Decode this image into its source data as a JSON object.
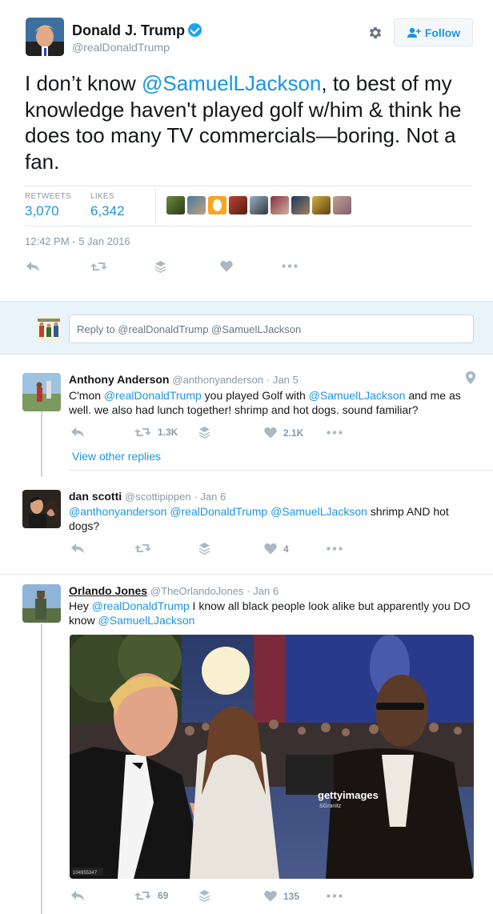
{
  "main_tweet": {
    "name": "Donald J. Trump",
    "handle": "@realDonaldTrump",
    "follow_label": "Follow",
    "text_before": "I don’t know ",
    "text_mention": "@SamuelLJackson",
    "text_after": ", to best of my knowledge haven't played golf w/him & think he does too many TV commercials—boring. Not a fan.",
    "retweets_label": "RETWEETS",
    "retweets": "3,070",
    "likes_label": "LIKES",
    "likes": "6,342",
    "timestamp": "12:42 PM - 5 Jan 2016"
  },
  "reply_box": {
    "placeholder": "Reply to @realDonaldTrump @SamuelLJackson"
  },
  "replies": [
    {
      "name": "Anthony Anderson",
      "handle": "@anthonyanderson",
      "date": "· Jan 5",
      "mention_a": "@realDonaldTrump",
      "mention_b": "@SamuelLJackson",
      "text_1": "C'mon ",
      "text_2": " you played Golf with ",
      "text_3": " and me as well. we also had lunch together! shrimp and hot dogs. sound familiar?",
      "retweets": "1.3K",
      "likes": "2.1K",
      "view_other": "View other replies"
    },
    {
      "name": "dan scotti",
      "handle": "@scottipippen",
      "date": "· Jan 6",
      "mention_a": "@anthonyanderson",
      "mention_b": "@realDonaldTrump",
      "mention_c": "@SamuelLJackson",
      "text_tail": " shrimp AND hot dogs?",
      "retweets": "",
      "likes": "4"
    },
    {
      "name": "Orlando Jones",
      "handle": "@TheOrlandoJones",
      "date": "· Jan 6",
      "text_1": "Hey ",
      "mention_a": "@realDonaldTrump",
      "text_2": " I know all black people look alike but apparently you DO know ",
      "mention_b": "@SamuelLJackson",
      "retweets": "69",
      "likes": "135",
      "watermark": "gettyimages",
      "watermark_credit": "SGranitz",
      "photo_id": "104955347"
    }
  ],
  "icons": [
    "gear-icon",
    "add-user-icon",
    "reply-icon",
    "retweet-icon",
    "stack-icon",
    "heart-icon",
    "more-icon",
    "location-icon",
    "verified-icon"
  ],
  "colors": {
    "link": "#1b95e0",
    "muted": "#8899a6",
    "reply_bg": "#e8f3fa"
  }
}
